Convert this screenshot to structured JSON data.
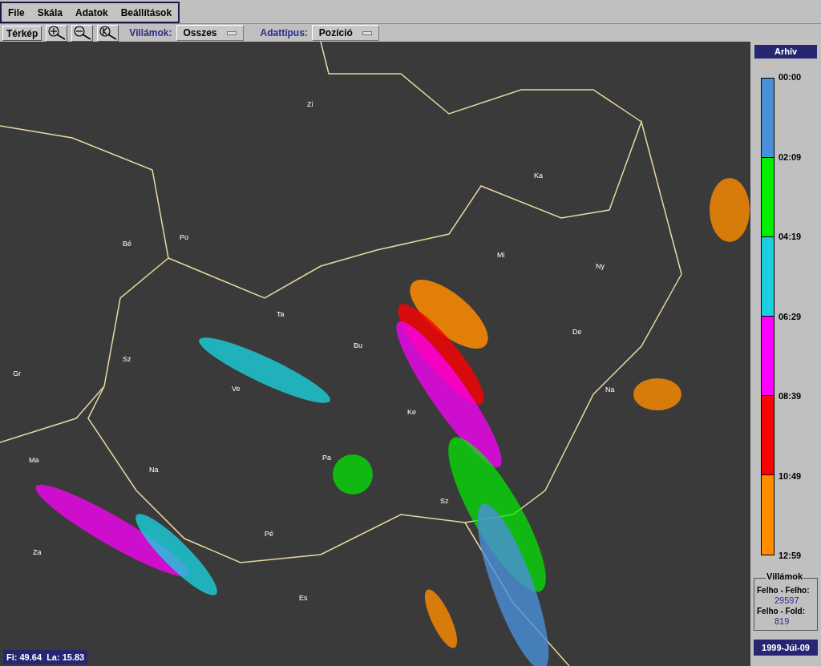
{
  "menu": [
    "File",
    "Skála",
    "Adatok",
    "Beállítások"
  ],
  "toolbar": {
    "map_button": "Térkép",
    "lightning_label": "Villámok:",
    "lightning_value": "Osszes",
    "type_label": "Adattípus:",
    "type_value": "Pozíció"
  },
  "map": {
    "places": [
      "Zi",
      "Ka",
      "Bé",
      "Po",
      "Mi",
      "Ny",
      "Ta",
      "De",
      "Bu",
      "Sz",
      "Gr",
      "Ve",
      "Na",
      "Ke",
      "Ma",
      "Na",
      "Pa",
      "Sz",
      "Pé",
      "Za",
      "Es"
    ],
    "coords": "Fi: 49.64  La: 15.83"
  },
  "legend": {
    "title": "Arhív",
    "segments": [
      {
        "color": "#4a90d9"
      },
      {
        "color": "#00ee00"
      },
      {
        "color": "#1ccfdc"
      },
      {
        "color": "#ff00ff"
      },
      {
        "color": "#ff0000"
      },
      {
        "color": "#ff8c00"
      }
    ],
    "labels": [
      "00:00",
      "02:09",
      "04:19",
      "06:29",
      "08:39",
      "10:49",
      "12:59"
    ]
  },
  "counts": {
    "title": "Villámok",
    "items": [
      {
        "label": "Felho - Felho:",
        "value": "29597"
      },
      {
        "label": "Felho - Fold:",
        "value": "819"
      }
    ]
  },
  "date": "1999-Júl-09"
}
